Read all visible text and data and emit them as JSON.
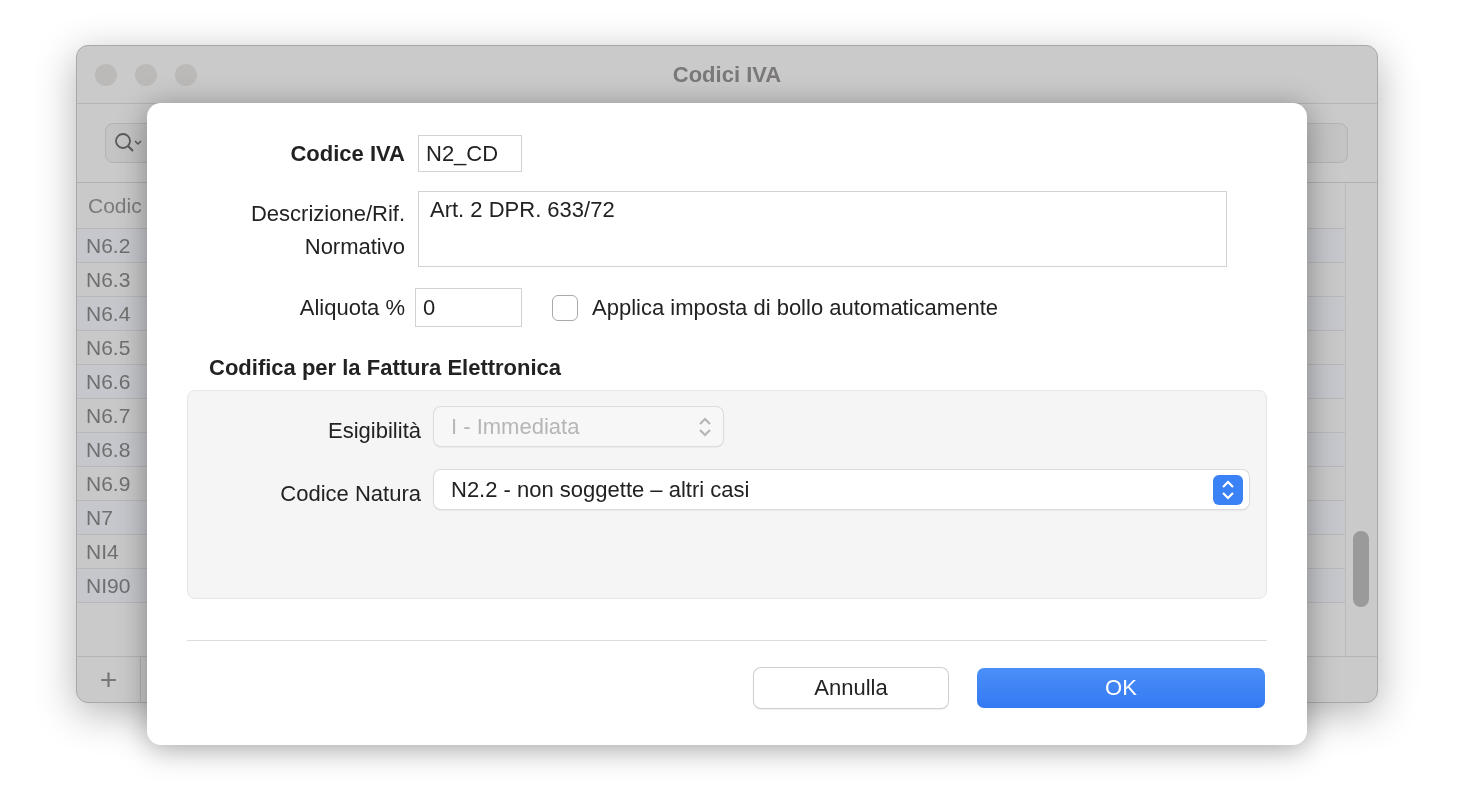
{
  "window": {
    "title": "Codici IVA"
  },
  "table": {
    "columns": [
      "Codic"
    ],
    "rows": [
      "N6.2",
      "N6.3",
      "N6.4",
      "N6.5",
      "N6.6",
      "N6.7",
      "N6.8",
      "N6.9",
      "N7",
      "NI4",
      "NI90"
    ]
  },
  "bottom_bar": {
    "add_button": "+"
  },
  "sheet": {
    "codice_iva": {
      "label": "Codice IVA",
      "value": "N2_CD"
    },
    "descrizione": {
      "label": "Descrizione/Rif. Normativo",
      "value": "Art. 2 DPR. 633/72"
    },
    "aliquota": {
      "label": "Aliquota %",
      "value": "0"
    },
    "bollo": {
      "label": "Applica imposta di bollo automaticamente",
      "checked": false
    },
    "section_title": "Codifica per la Fattura Elettronica",
    "popups": [
      {
        "label": "Esigibilità",
        "value": "I - Immediata",
        "disabled": true,
        "kind": "short"
      },
      {
        "label": "Codice Natura",
        "value": "N2.2 - non soggette – altri casi",
        "disabled": false,
        "kind": "wide"
      }
    ],
    "buttons": [
      {
        "label": "Annulla",
        "default": false
      },
      {
        "label": "OK",
        "default": true
      }
    ]
  }
}
